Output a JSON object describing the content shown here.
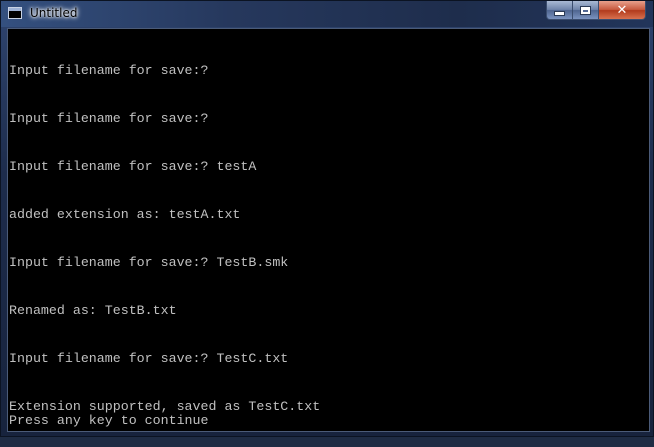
{
  "window": {
    "title": "Untitled",
    "close_glyph": "✕"
  },
  "console": {
    "lines": [
      "Input filename for save:?",
      "Input filename for save:?",
      "Input filename for save:? testA",
      "added extension as: testA.txt",
      "Input filename for save:? TestB.smk",
      "Renamed as: TestB.txt",
      "Input filename for save:? TestC.txt",
      "Extension supported, saved as TestC.txt"
    ],
    "footer": "Press any key to continue"
  },
  "colors": {
    "console_background": "#000000",
    "console_text": "#c0c0c0",
    "close_button": "#c75a3f"
  },
  "icons": {
    "app": "console-window-icon",
    "minimize": "minimize-icon",
    "maximize": "maximize-icon",
    "close": "close-icon"
  }
}
